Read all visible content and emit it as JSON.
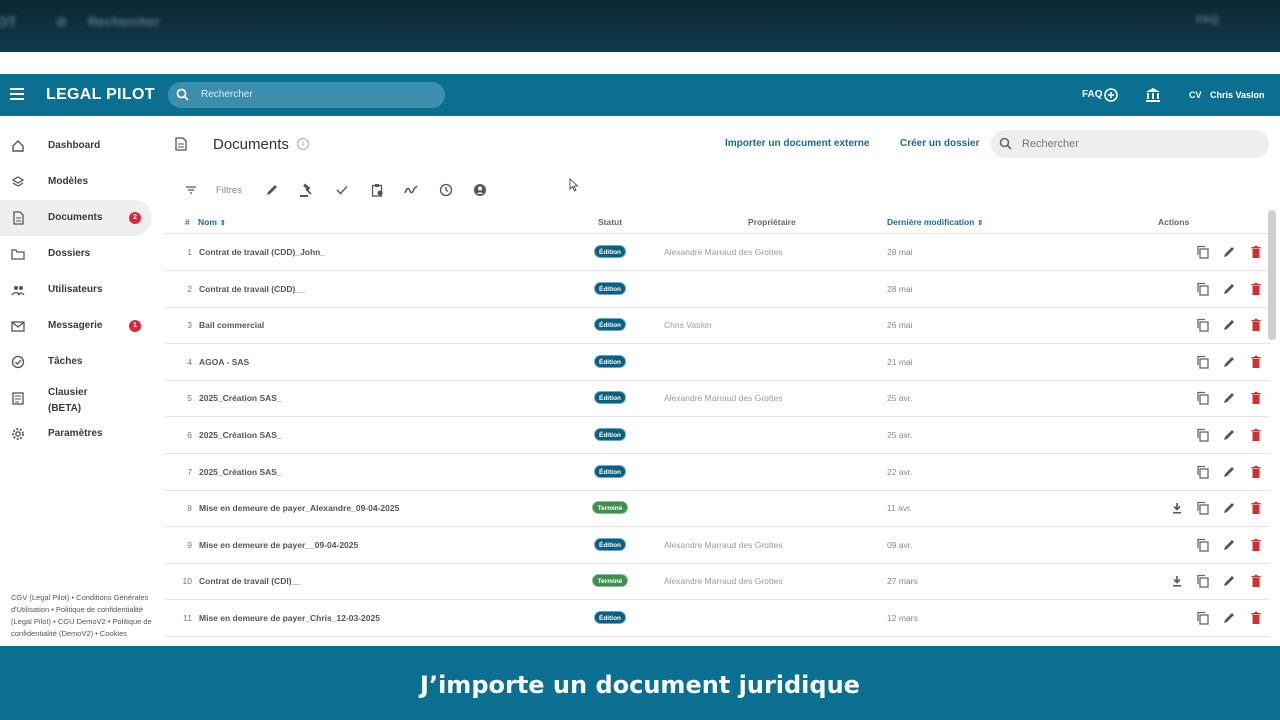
{
  "top_blur": {
    "left_text": "Rechercher",
    "right_text": "FAQ"
  },
  "header": {
    "logo": "LEGAL PILOT",
    "search_placeholder": "Rechercher",
    "faq_label": "FAQ",
    "user_initials": "CV",
    "user_name": "Chris Vaslon",
    "brand_color": "#0b6f92"
  },
  "sidebar": {
    "items": [
      {
        "label": "Dashboard",
        "icon": "home-icon"
      },
      {
        "label": "Modèles",
        "icon": "layers-icon"
      },
      {
        "label": "Documents",
        "icon": "document-icon",
        "badge": "2",
        "active": true
      },
      {
        "label": "Dossiers",
        "icon": "folder-icon"
      },
      {
        "label": "Utilisateurs",
        "icon": "users-icon"
      },
      {
        "label": "Messagerie",
        "icon": "mail-icon",
        "badge": "1"
      },
      {
        "label": "Tâches",
        "icon": "check-circle-icon"
      },
      {
        "label": "Clausier",
        "label2": "(BETA)",
        "icon": "list-icon"
      },
      {
        "label": "Paramètres",
        "icon": "gear-icon"
      }
    ],
    "footer": "CGV (Legal Pilot) • Conditions Générales d'Utilisation • Politique de confidentialité (Legal Pilot) • CGU DemoV2 • Politique de confidentialité (DemoV2) • Cookies"
  },
  "main": {
    "title": "Documents",
    "import_link": "Importer un document externe",
    "create_folder_link": "Créer un dossier",
    "search_placeholder": "Rechercher",
    "filters_label": "Filtres"
  },
  "table": {
    "headers": {
      "num": "#",
      "name": "Nom",
      "status": "Statut",
      "owner": "Propriétaire",
      "modified": "Dernière modification",
      "actions": "Actions"
    },
    "rows": [
      {
        "num": "1",
        "name": "Contrat de travail (CDD)_John_",
        "status": "Édition",
        "owner": "Alexandre Marraud des Grottes",
        "date": "28 mai",
        "download": false
      },
      {
        "num": "2",
        "name": "Contrat de travail (CDD)__",
        "status": "Édition",
        "owner": "",
        "date": "28 mai",
        "download": false
      },
      {
        "num": "3",
        "name": "Bail commercial",
        "status": "Édition",
        "owner": "Chris Vaslon",
        "date": "26 mai",
        "download": false
      },
      {
        "num": "4",
        "name": "AGOA - SAS",
        "status": "Édition",
        "owner": "",
        "date": "21 mai",
        "download": false
      },
      {
        "num": "5",
        "name": "2025_Création SAS_",
        "status": "Édition",
        "owner": "Alexandre Marraud des Grottes",
        "date": "25 avr.",
        "download": false
      },
      {
        "num": "6",
        "name": "2025_Création SAS_",
        "status": "Édition",
        "owner": "",
        "date": "25 avr.",
        "download": false
      },
      {
        "num": "7",
        "name": "2025_Création SAS_",
        "status": "Édition",
        "owner": "",
        "date": "22 avr.",
        "download": false
      },
      {
        "num": "8",
        "name": "Mise en demeure de payer_Alexandre_09-04-2025",
        "status": "Terminé",
        "owner": "",
        "date": "11 avr.",
        "download": true
      },
      {
        "num": "9",
        "name": "Mise en demeure de payer__09-04-2025",
        "status": "Édition",
        "owner": "Alexandre Marraud des Grottes",
        "date": "09 avr.",
        "download": false
      },
      {
        "num": "10",
        "name": "Contrat de travail (CDI)__",
        "status": "Terminé",
        "owner": "Alexandre Marraud des Grottes",
        "date": "27 mars",
        "download": true
      },
      {
        "num": "11",
        "name": "Mise en demeure de payer_Chris_12-03-2025",
        "status": "Édition",
        "owner": "",
        "date": "12 mars",
        "download": false
      }
    ]
  },
  "caption": "J’importe un document juridique"
}
